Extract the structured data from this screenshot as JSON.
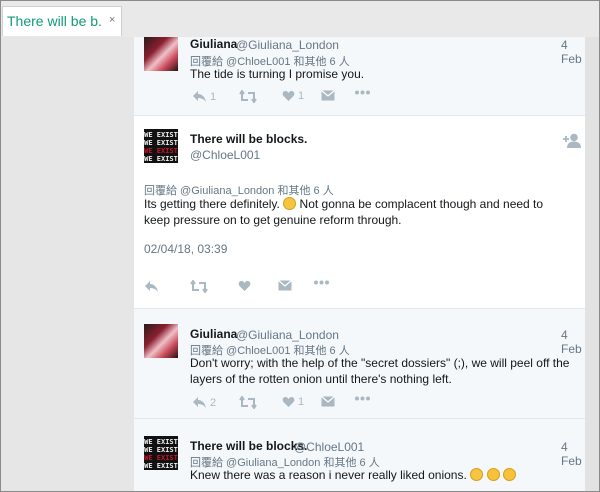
{
  "tab": {
    "title": "There will be b...",
    "close": "×"
  },
  "tweets": [
    {
      "name": "Giuliana",
      "handle": "@Giuliana_London",
      "date": "4 Feb",
      "reply_to": "回覆給 @ChloeL001 和其他 6 人",
      "text": "The tide is turning I promise you.",
      "reply_count": "1",
      "retweet_count": "",
      "like_count": "1"
    },
    {
      "name": "There will be blocks.",
      "handle": "@ChloeL001",
      "reply_to": "回覆給 @Giuliana_London 和其他 6 人",
      "text_before_emoji": "Its getting there definitely.",
      "text_after_emoji": " Not gonna be complacent though and need to keep pressure on to get genuine reform through.",
      "timestamp": "02/04/18, 03:39",
      "avatar_lines": [
        "WE EXIST",
        "WE EXIST",
        "WE EXIST",
        "WE EXIST"
      ]
    },
    {
      "name": "Giuliana",
      "handle": "@Giuliana_London",
      "date": "4 Feb",
      "reply_to": "回覆給 @ChloeL001 和其他 6 人",
      "text": "Don't worry; with the help of the \"secret dossiers\" (;), we will peel off the layers of the rotten onion until there's nothing left.",
      "reply_count": "2",
      "retweet_count": "",
      "like_count": "1"
    },
    {
      "name": "There will be blocks.",
      "handle": "@ChloeL001",
      "date": "4 Feb",
      "reply_to": "回覆給 @Giuliana_London 和其他 6 人",
      "text": "Knew there was a reason i never really liked onions.",
      "avatar_lines": [
        "WE EXIST",
        "WE EXIST",
        "WE EXIST",
        "WE EXIST"
      ]
    }
  ],
  "icons": {
    "reply": "reply-icon",
    "retweet": "retweet-icon",
    "like": "heart-icon",
    "dm": "envelope-icon",
    "more": "more-icon",
    "follow": "follow-user-icon"
  }
}
